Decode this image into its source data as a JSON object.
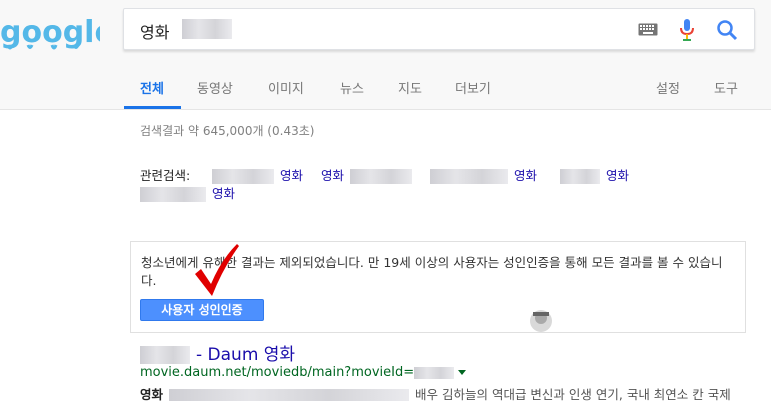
{
  "search": {
    "query": "영화"
  },
  "tabs": [
    {
      "label": "전체",
      "active": true
    },
    {
      "label": "동영상"
    },
    {
      "label": "이미지"
    },
    {
      "label": "뉴스"
    },
    {
      "label": "지도"
    },
    {
      "label": "더보기"
    }
  ],
  "tools": {
    "settings": "설정",
    "tools": "도구"
  },
  "stats": "검색결과 약 645,000개 (0.43초)",
  "related": {
    "label": "관련검색:",
    "items": [
      "영화",
      "영화",
      "영화",
      "영화",
      "영화"
    ]
  },
  "safe_search": {
    "message": "청소년에게 유해한 결과는 제외되었습니다. 만 19세 이상의 사용자는 성인인증을 통해 모든 결과를 볼 수 있습니다.",
    "button": "사용자 성인인증"
  },
  "result": {
    "title_suffix": "- Daum 영화",
    "url": "movie.daum.net/moviedb/main?movieId=",
    "snippet_lead": "영화",
    "snippet": "배우 김하늘의 역대급 변신과 인생 연기, 국내 최연소 칸 국제"
  },
  "colors": {
    "accent": "#1a73e8",
    "link": "#1a0dab",
    "url": "#006621",
    "button": "#4d90fe"
  },
  "icons": [
    "keyboard-icon",
    "mic-icon",
    "search-icon",
    "checkmark-icon",
    "avatar"
  ]
}
